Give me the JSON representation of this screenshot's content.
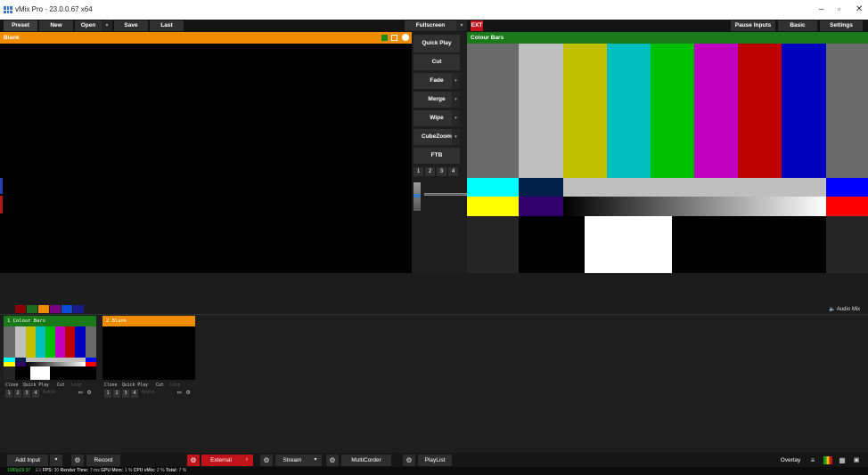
{
  "window": {
    "title": "vMix Pro - 23.0.0.67 x64"
  },
  "toolbar": {
    "preset": "Preset",
    "new": "New",
    "open": "Open",
    "save": "Save",
    "last": "Last",
    "fullscreen": "Fullscreen",
    "ext": "EXT",
    "pause_inputs": "Pause Inputs",
    "basic": "Basic",
    "settings": "Settings"
  },
  "preview": {
    "title": "Blank",
    "header_color": "#f08c00"
  },
  "program": {
    "title": "Colour Bars",
    "header_color": "#1a7a1a"
  },
  "transitions": {
    "quick_play": "Quick Play",
    "cut": "Cut",
    "fade": "Fade",
    "merge": "Merge",
    "wipe": "Wipe",
    "cubezoom": "CubeZoom",
    "ftb": "FTB",
    "numbers": [
      "1",
      "2",
      "3",
      "4"
    ]
  },
  "colour_boxes": [
    "#8b0000",
    "#1f6b1f",
    "#f08c00",
    "#7a0080",
    "#0a4bd8",
    "#1a1a8a"
  ],
  "audio_mixer_label": "Audio Mix",
  "inputs": [
    {
      "number": "1",
      "title": "Colour Bars",
      "header_color": "#1a7a1a",
      "controls": [
        "Close",
        "Quick Play",
        "Cut",
        "Loop"
      ],
      "slots": [
        "1",
        "2",
        "3",
        "4"
      ],
      "audio": "Audio"
    },
    {
      "number": "2",
      "title": "Blank",
      "header_color": "#f08c00",
      "controls": [
        "Close",
        "Quick Play",
        "Cut",
        "Loop"
      ],
      "slots": [
        "1",
        "2",
        "3",
        "4"
      ],
      "audio": "Audio"
    }
  ],
  "bottom": {
    "add_input": "Add Input",
    "record": "Record",
    "external": "External",
    "stream": "Stream",
    "multicorder": "MultiCorder",
    "playlist": "PlayList",
    "overlay": "Overlay"
  },
  "status": {
    "format": "1080p29.97",
    "ex": "EX",
    "fps_label": "FPS:",
    "fps": "30",
    "render_label": "Render Time:",
    "render": "7 ms",
    "gpu_label": "GPU Mem:",
    "gpu": "1 %",
    "cpu_label": "CPU vMix:",
    "cpu": "2 %",
    "total_label": "Total:",
    "total": "7 %"
  },
  "colors": {
    "bars_top": [
      "#bfbfbf",
      "#c0c000",
      "#00bfbf",
      "#00bf00",
      "#bf00bf",
      "#bf0000",
      "#0000bf"
    ],
    "preview_accent": "#f08c00",
    "program_accent": "#1a7a1a",
    "external_red": "#c0141a"
  }
}
